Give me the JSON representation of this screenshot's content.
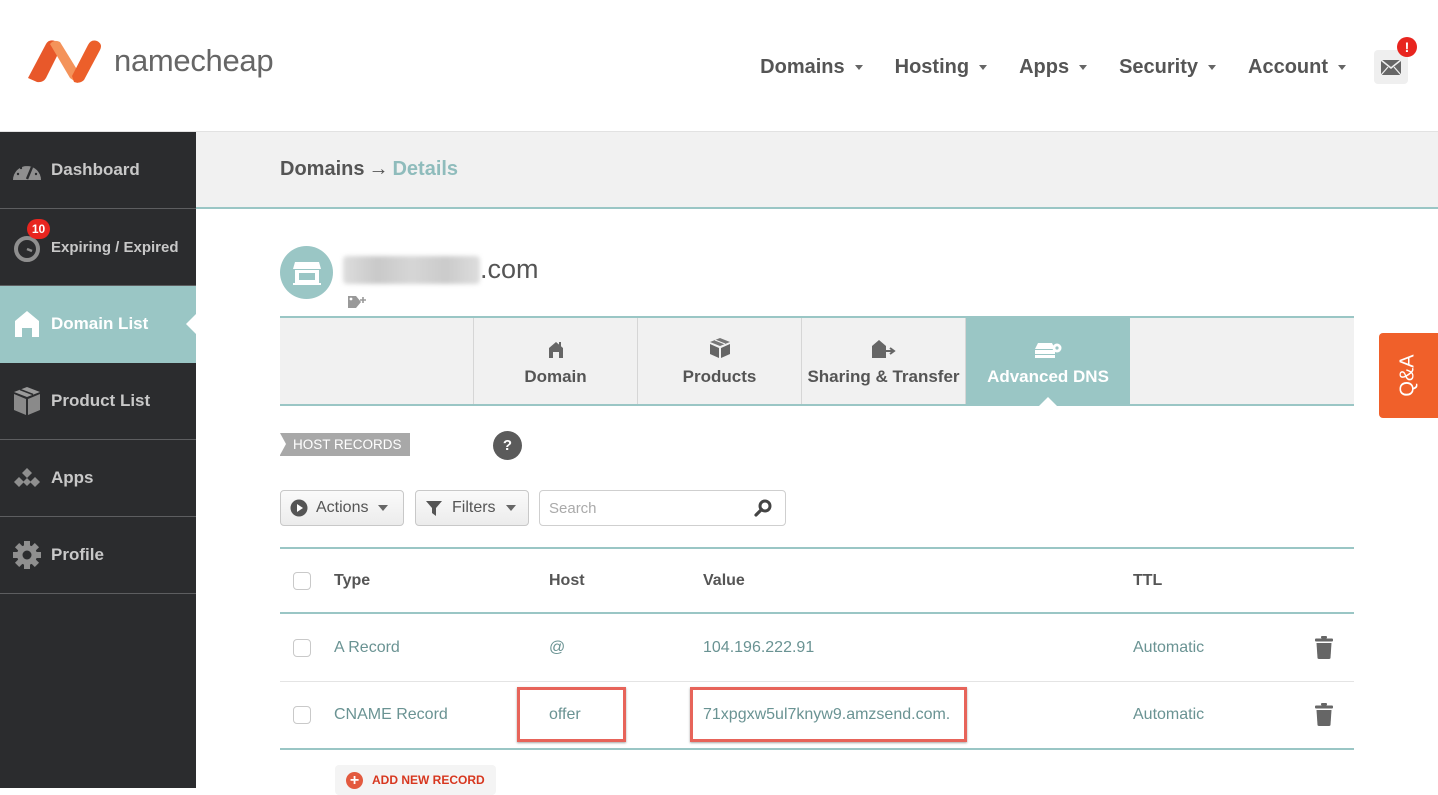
{
  "brand": {
    "name": "namecheap",
    "accent": "#f0602a",
    "teal": "#9ac6c5"
  },
  "topnav": {
    "items": [
      {
        "label": "Domains"
      },
      {
        "label": "Hosting"
      },
      {
        "label": "Apps"
      },
      {
        "label": "Security"
      },
      {
        "label": "Account"
      }
    ],
    "mail_alert": "!"
  },
  "sidebar": {
    "items": [
      {
        "label": "Dashboard",
        "icon": "gauge-icon"
      },
      {
        "label": "Expiring / Expired",
        "icon": "stopwatch-icon",
        "badge": "10"
      },
      {
        "label": "Domain List",
        "icon": "home-icon",
        "active": true
      },
      {
        "label": "Product List",
        "icon": "box-icon"
      },
      {
        "label": "Apps",
        "icon": "apps-diamond-icon"
      },
      {
        "label": "Profile",
        "icon": "gear-icon"
      }
    ]
  },
  "breadcrumb": {
    "parent": "Domains",
    "separator": "→",
    "current": "Details"
  },
  "domain": {
    "name_suffix": ".com",
    "name_hidden": true
  },
  "tabs": [
    {
      "label": "Domain",
      "icon": "house-icon"
    },
    {
      "label": "Products",
      "icon": "box-icon"
    },
    {
      "label": "Sharing & Transfer",
      "icon": "house-transfer-icon"
    },
    {
      "label": "Advanced DNS",
      "icon": "dns-server-icon",
      "active": true
    }
  ],
  "section": {
    "label": "HOST RECORDS",
    "help": "?"
  },
  "toolbar": {
    "actions_label": "Actions",
    "filters_label": "Filters",
    "search_placeholder": "Search",
    "search_value": ""
  },
  "table": {
    "headers": {
      "type": "Type",
      "host": "Host",
      "value": "Value",
      "ttl": "TTL"
    },
    "rows": [
      {
        "type": "A Record",
        "host": "@",
        "value": "104.196.222.91",
        "ttl": "Automatic",
        "highlighted": false
      },
      {
        "type": "CNAME Record",
        "host": "offer",
        "value": "71xpgxw5ul7knyw9.amzsend.com.",
        "ttl": "Automatic",
        "highlighted": true
      }
    ],
    "add_label": "ADD NEW RECORD"
  },
  "qa_tab": {
    "label": "Q&A"
  }
}
